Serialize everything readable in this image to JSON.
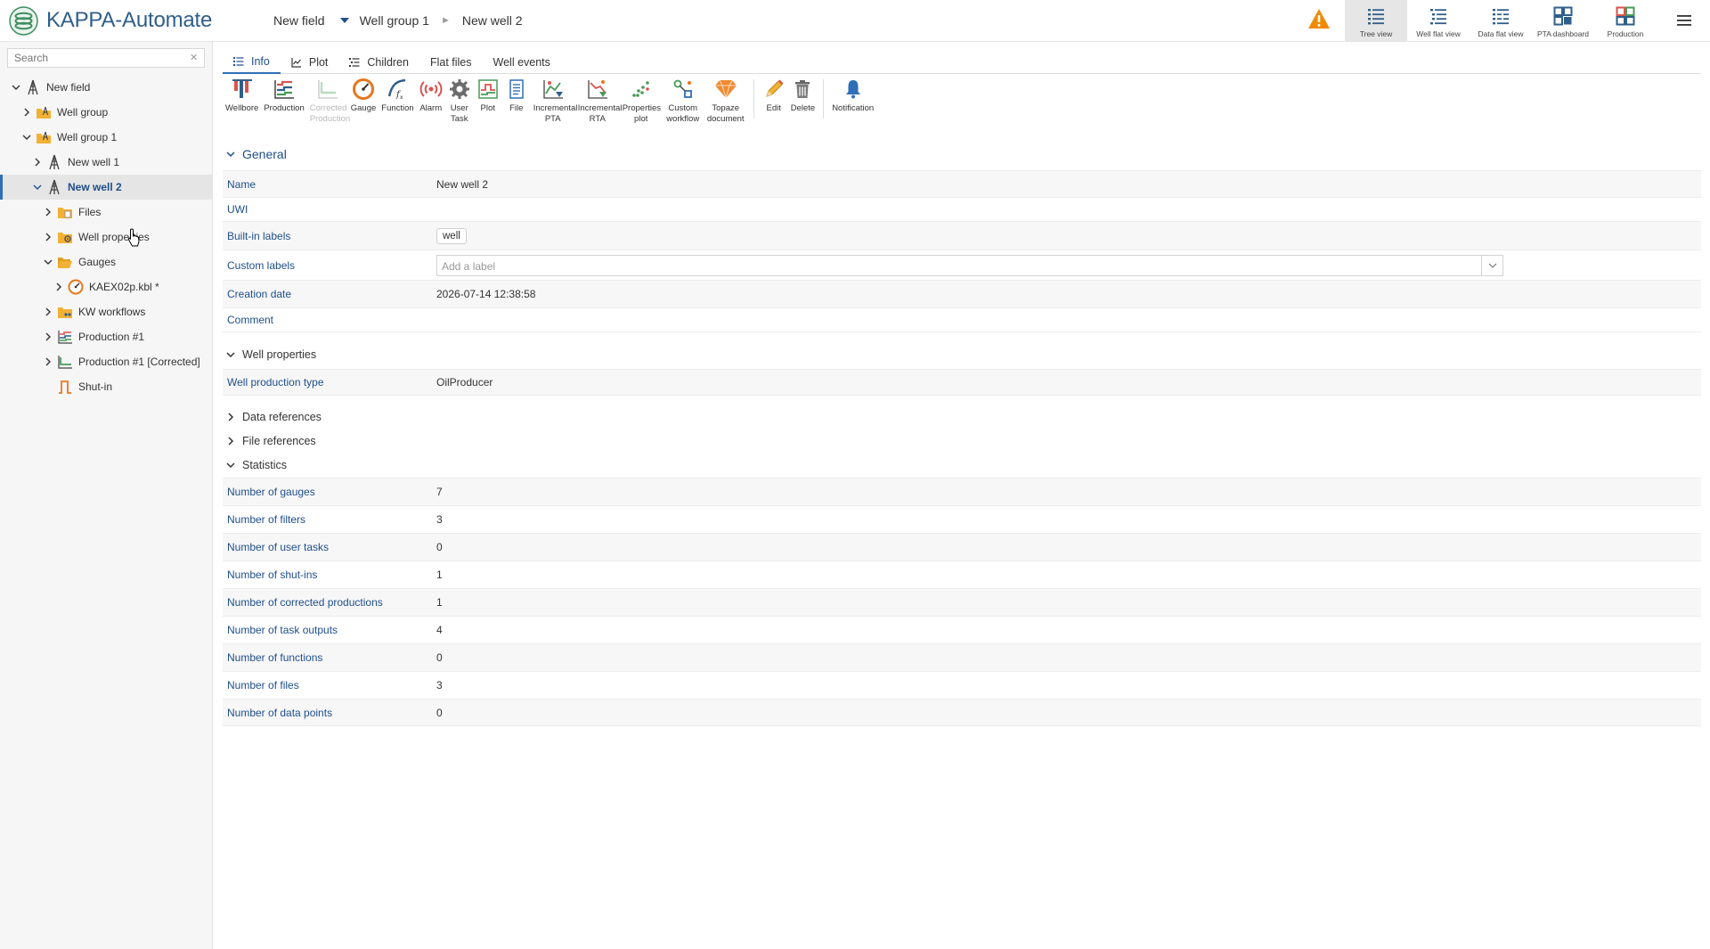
{
  "app": {
    "title": "KAPPA-Automate"
  },
  "breadcrumb": [
    "New field",
    "Well group 1",
    "New well 2"
  ],
  "views": [
    {
      "label": "Tree view",
      "icon": "tree-view-icon"
    },
    {
      "label": "Well flat view",
      "icon": "well-flat-view-icon"
    },
    {
      "label": "Data flat view",
      "icon": "data-flat-view-icon"
    },
    {
      "label": "PTA dashboard",
      "icon": "pta-dashboard-icon"
    },
    {
      "label": "Production",
      "icon": "production-dashboard-icon"
    }
  ],
  "sidebar": {
    "search_placeholder": "Search",
    "tree": [
      {
        "label": "New field",
        "icon": "field-icon",
        "expanded": true
      },
      {
        "label": "Well group",
        "icon": "well-group-icon",
        "expanded": false
      },
      {
        "label": "Well group 1",
        "icon": "well-group-icon",
        "expanded": true
      },
      {
        "label": "New well 1",
        "icon": "well-icon",
        "expanded": false
      },
      {
        "label": "New well 2",
        "icon": "well-icon",
        "expanded": true,
        "selected": true
      },
      {
        "label": "Files",
        "icon": "folder-icon",
        "expanded": false
      },
      {
        "label": "Well properties",
        "icon": "well-properties-icon",
        "expanded": false
      },
      {
        "label": "Gauges",
        "icon": "folder-open-icon",
        "expanded": true
      },
      {
        "label": "KAEX02p.kbl *",
        "icon": "gauge-icon",
        "expanded": false
      },
      {
        "label": "KW workflows",
        "icon": "workflow-folder-icon",
        "expanded": false
      },
      {
        "label": "Production #1",
        "icon": "production-icon",
        "expanded": false
      },
      {
        "label": "Production #1 [Corrected]",
        "icon": "corrected-production-icon",
        "expanded": false
      },
      {
        "label": "Shut-in",
        "icon": "shut-in-icon"
      }
    ]
  },
  "tabs": [
    "Info",
    "Plot",
    "Children",
    "Flat files",
    "Well events"
  ],
  "toolbar": {
    "items": [
      {
        "label": "Wellbore",
        "icon": "wellbore-icon"
      },
      {
        "label": "Production",
        "icon": "production-icon"
      },
      {
        "label": "Corrected Production",
        "icon": "corrected-production-icon",
        "disabled": true
      },
      {
        "label": "Gauge",
        "icon": "gauge-icon"
      },
      {
        "label": "Function",
        "icon": "function-icon"
      },
      {
        "label": "Alarm",
        "icon": "alarm-icon"
      },
      {
        "label": "User Task",
        "icon": "user-task-icon"
      },
      {
        "label": "Plot",
        "icon": "plot-icon"
      },
      {
        "label": "File",
        "icon": "file-icon"
      },
      {
        "label": "Incremental PTA",
        "icon": "incremental-pta-icon"
      },
      {
        "label": "Incremental RTA",
        "icon": "incremental-rta-icon"
      },
      {
        "label": "Properties plot",
        "icon": "properties-plot-icon"
      },
      {
        "label": "Custom workflow",
        "icon": "custom-workflow-icon"
      },
      {
        "label": "Topaze document",
        "icon": "topaze-document-icon"
      },
      {
        "label": "Edit",
        "icon": "edit-icon"
      },
      {
        "label": "Delete",
        "icon": "delete-icon"
      },
      {
        "label": "Notification",
        "icon": "notification-icon"
      }
    ]
  },
  "general": {
    "title": "General",
    "rows": [
      {
        "key": "Name",
        "value": "New well 2"
      },
      {
        "key": "UWI",
        "value": ""
      },
      {
        "key": "Built-in labels",
        "value": "well"
      },
      {
        "key": "Custom labels",
        "placeholder": "Add a label"
      },
      {
        "key": "Creation date",
        "value": "2026-07-14 12:38:58"
      },
      {
        "key": "Comment",
        "value": ""
      }
    ]
  },
  "well_properties": {
    "title": "Well properties",
    "rows": [
      {
        "key": "Well production type",
        "value": "OilProducer"
      }
    ]
  },
  "data_references": {
    "title": "Data references"
  },
  "file_references": {
    "title": "File references"
  },
  "statistics": {
    "title": "Statistics",
    "rows": [
      {
        "key": "Number of gauges",
        "value": "7"
      },
      {
        "key": "Number of filters",
        "value": "3"
      },
      {
        "key": "Number of user tasks",
        "value": "0"
      },
      {
        "key": "Number of shut-ins",
        "value": "1"
      },
      {
        "key": "Number of corrected productions",
        "value": "1"
      },
      {
        "key": "Number of task outputs",
        "value": "4"
      },
      {
        "key": "Number of functions",
        "value": "0"
      },
      {
        "key": "Number of files",
        "value": "3"
      },
      {
        "key": "Number of data points",
        "value": "0"
      }
    ]
  },
  "colors": {
    "accent": "#1f4e8c",
    "warning": "#f08a00",
    "selected_bar": "#2f6fb7"
  }
}
